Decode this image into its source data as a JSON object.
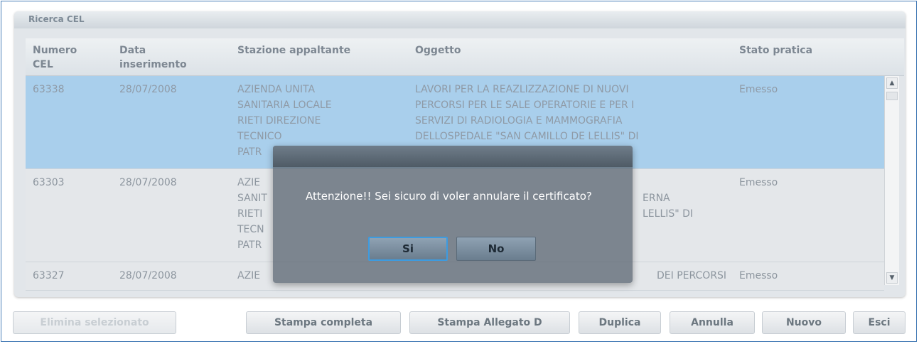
{
  "panel": {
    "title": "Ricerca CEL"
  },
  "table": {
    "columns": [
      {
        "label": "Numero\nCEL"
      },
      {
        "label": "Data\ninserimento"
      },
      {
        "label": "Stazione appaltante"
      },
      {
        "label": "Oggetto"
      },
      {
        "label": "Stato pratica"
      }
    ],
    "rows": [
      {
        "numero": "63338",
        "data": "28/07/2008",
        "stazione": "AZIENDA UNITA\nSANITARIA LOCALE\nRIETI DIREZIONE\nTECNICO\nPATR",
        "oggetto": "LAVORI PER LA REAZLIZZAZIONE DI NUOVI\nPERCORSI PER LE SALE OPERATORIE E PER I\nSERVIZI DI RADIOLOGIA E MAMMOGRAFIA\nDELLOSPEDALE \"SAN CAMILLO DE LELLIS\" DI",
        "stato": "Emesso",
        "selected": true
      },
      {
        "numero": "63303",
        "data": "28/07/2008",
        "stazione": "AZIE\nSANIT\nRIETI\nTECN\nPATR",
        "oggetto": "\nERNA\nLELLIS\" DI",
        "stato": "Emesso",
        "selected": false
      },
      {
        "numero": "63327",
        "data": "28/07/2008",
        "stazione": "AZIE",
        "oggetto": "DEI PERCORSI",
        "stato": "Emesso",
        "selected": false
      }
    ]
  },
  "scrollbar": {
    "up_icon": "arrow-up-icon",
    "down_icon": "arrow-down-icon"
  },
  "buttons": {
    "elimina": "Elimina selezionato",
    "stampa_completa": "Stampa completa",
    "stampa_allegato": "Stampa Allegato D",
    "duplica": "Duplica",
    "annulla": "Annulla",
    "nuovo": "Nuovo",
    "esci": "Esci"
  },
  "dialog": {
    "message": "Attenzione!! Sei sicuro di voler annulare il certificato?",
    "yes": "Si",
    "no": "No"
  },
  "colors": {
    "selected_row": "#a9cfec",
    "frame_border": "#4a7fb8",
    "focus_border": "#3d9be0"
  }
}
